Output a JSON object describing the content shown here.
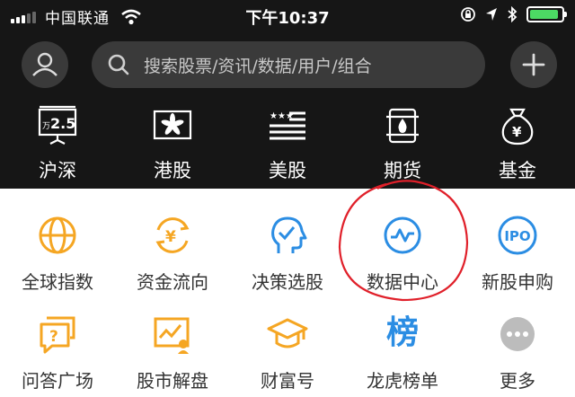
{
  "status_bar": {
    "carrier": "中国联通",
    "time": "下午10:37",
    "battery_level": 0.9,
    "battery_color": "#4cd964"
  },
  "header": {
    "avatar_icon": "user-icon",
    "search_placeholder": "搜索股票/资讯/数据/用户/组合",
    "add_icon": "plus-icon"
  },
  "markets": [
    {
      "label": "沪深",
      "icon": "flag-25-icon",
      "badge": "2.5",
      "badge_prefix": "万"
    },
    {
      "label": "港股",
      "icon": "hong-kong-flag-icon"
    },
    {
      "label": "美股",
      "icon": "us-flag-icon"
    },
    {
      "label": "期货",
      "icon": "oil-barrel-icon"
    },
    {
      "label": "基金",
      "icon": "money-bag-icon",
      "symbol": "¥"
    }
  ],
  "features_row1": [
    {
      "label": "全球指数",
      "icon": "globe-icon"
    },
    {
      "label": "资金流向",
      "icon": "yen-flow-icon",
      "symbol": "¥"
    },
    {
      "label": "决策选股",
      "icon": "head-check-icon"
    },
    {
      "label": "数据中心",
      "icon": "pulse-icon"
    },
    {
      "label": "新股申购",
      "icon": "ipo-icon",
      "badge": "IPO"
    }
  ],
  "features_row2": [
    {
      "label": "问答广场",
      "icon": "qa-icon",
      "symbol": "?"
    },
    {
      "label": "股市解盘",
      "icon": "chart-board-icon"
    },
    {
      "label": "财富号",
      "icon": "graduation-cap-icon"
    },
    {
      "label": "龙虎榜单",
      "icon": "bang-text-icon",
      "glyph": "榜"
    },
    {
      "label": "更多",
      "icon": "more-icon"
    }
  ],
  "colors": {
    "orange": "#f5a623",
    "blue": "#2b8de3",
    "highlight_circle": "#e0202a"
  }
}
